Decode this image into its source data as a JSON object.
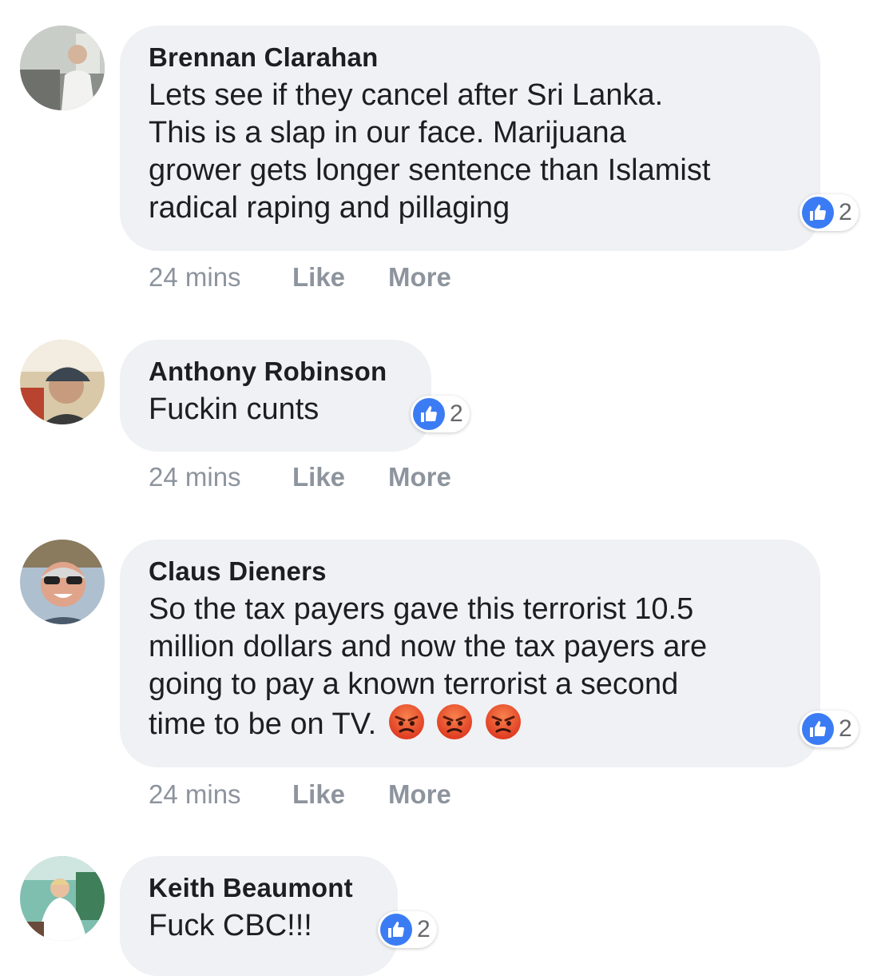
{
  "comments": [
    {
      "author": "Brennan Clarahan",
      "lines": [
        "Lets see if they cancel after Sri Lanka.",
        "This is a slap in our face. Marijuana",
        "grower gets longer sentence than Islamist",
        "radical raping and pillaging"
      ],
      "reaction_count": "2",
      "time": "24 mins",
      "like_label": "Like",
      "more_label": "More"
    },
    {
      "author": "Anthony Robinson",
      "lines": [
        "Fuckin cunts"
      ],
      "reaction_count": "2",
      "time": "24 mins",
      "like_label": "Like",
      "more_label": "More"
    },
    {
      "author": "Claus Dieners",
      "lines": [
        "So the tax payers gave this terrorist 10.5",
        "million dollars and now the tax payers are",
        "going to pay a known terrorist a second",
        "time to be on TV."
      ],
      "emojis": [
        "angry-emoji",
        "angry-emoji",
        "angry-emoji"
      ],
      "reaction_count": "2",
      "time": "24 mins",
      "like_label": "Like",
      "more_label": "More"
    },
    {
      "author": "Keith Beaumont",
      "lines": [
        "Fuck CBC!!!"
      ],
      "reaction_count": "2"
    }
  ],
  "icons": {
    "reaction": "like-thumb-icon",
    "emoji": "angry-emoji"
  },
  "colors": {
    "bubble_bg": "#f0f1f4",
    "like_blue": "#3b7cf4",
    "meta_gray": "#8d949e",
    "angry_red": "#e8542c"
  }
}
